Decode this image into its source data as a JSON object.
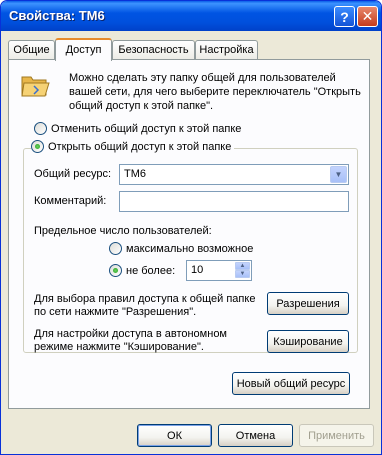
{
  "window": {
    "title": "Свойства: ТМ6",
    "help_glyph": "?",
    "close_glyph": "✕"
  },
  "tabs": [
    {
      "label": "Общие"
    },
    {
      "label": "Доступ"
    },
    {
      "label": "Безопасность"
    },
    {
      "label": "Настройка"
    }
  ],
  "sharing": {
    "info": "Можно сделать эту папку общей для пользователей вашей сети, для чего выберите переключатель \"Открыть общий доступ к этой папке\".",
    "radio_unshare": "Отменить общий доступ к этой папке",
    "radio_share": "Открыть общий доступ к этой папке",
    "share_name_label": "Общий ресурс:",
    "share_name_value": "ТМ6",
    "comment_label": "Комментарий:",
    "comment_value": "",
    "user_limit_label": "Предельное число пользователей:",
    "max_allowed_label": "максимально возможное",
    "allow_label": "не более:",
    "allow_value": "10",
    "permissions_text": "Для выбора правил доступа к общей папке по сети нажмите \"Разрешения\".",
    "permissions_button": "Разрешения",
    "caching_text": "Для настройки доступа в автономном режиме нажмите \"Кэширование\".",
    "caching_button": "Кэширование",
    "new_share_button": "Новый общий ресурс"
  },
  "footer": {
    "ok": "ОК",
    "cancel": "Отмена",
    "apply": "Применить"
  },
  "icons": {
    "folder": "shared-folder-icon",
    "dropdown": "chevron-down-icon"
  },
  "colors": {
    "titlebar": "#0054e3",
    "active_tab_accent": "#e68b2c",
    "dialog_bg": "#ece9d8"
  }
}
